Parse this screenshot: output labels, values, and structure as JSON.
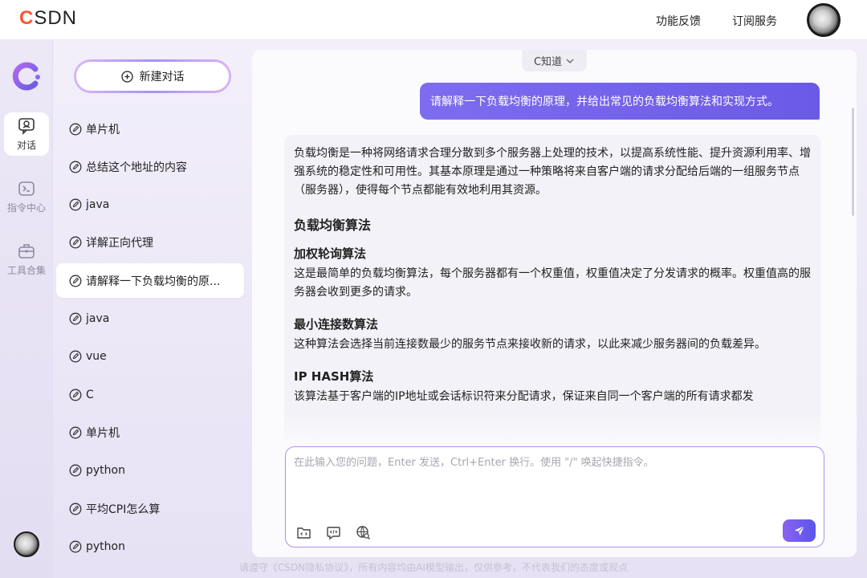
{
  "header": {
    "logo": "CSDN",
    "links": [
      "功能反馈",
      "订阅服务"
    ]
  },
  "rail": {
    "items": [
      {
        "label": "对话",
        "icon": "chat-bubble-icon",
        "active": true
      },
      {
        "label": "指令中心",
        "icon": "terminal-icon",
        "active": false
      },
      {
        "label": "工具合集",
        "icon": "briefcase-icon",
        "active": false
      }
    ]
  },
  "sidebar": {
    "new_chat_label": "新建对话",
    "conversations": [
      {
        "title": "单片机"
      },
      {
        "title": "总结这个地址的内容"
      },
      {
        "title": "java"
      },
      {
        "title": "详解正向代理"
      },
      {
        "title": "请解释一下负载均衡的原...",
        "active": true
      },
      {
        "title": "java"
      },
      {
        "title": "vue"
      },
      {
        "title": "C"
      },
      {
        "title": "单片机"
      },
      {
        "title": "python"
      },
      {
        "title": "平均CPI怎么算"
      },
      {
        "title": "python"
      }
    ]
  },
  "chat": {
    "model_select": "C知道",
    "user_message": "请解释一下负载均衡的原理，并给出常见的负载均衡算法和实现方式。",
    "ai_message": {
      "intro": "负载均衡是一种将网络请求合理分散到多个服务器上处理的技术，以提高系统性能、提升资源利用率、增强系统的稳定性和可用性。其基本原理是通过一种策略将来自客户端的请求分配给后端的一组服务节点（服务器），使得每个节点都能有效地利用其资源。",
      "heading": "负载均衡算法",
      "sections": [
        {
          "title": "加权轮询算法",
          "body": "这是最简单的负载均衡算法，每个服务器都有一个权重值，权重值决定了分发请求的概率。权重值高的服务器会收到更多的请求。"
        },
        {
          "title": "最小连接数算法",
          "body": "这种算法会选择当前连接数最少的服务节点来接收新的请求，以此来减少服务器间的负载差异。"
        },
        {
          "title": "IP HASH算法",
          "body": "该算法基于客户端的IP地址或会话标识符来分配请求，保证来自同一个客户端的所有请求都发"
        }
      ]
    },
    "input": {
      "placeholder": "在此输入您的问题，Enter 发送，Ctrl+Enter 换行。使用 \"/\" 唤起快捷指令。",
      "value": ""
    }
  },
  "footer": {
    "note": "请遵守《CSDN隐私协议》，所有内容均由AI模型输出，仅供参考，不代表我们的态度或观点"
  },
  "colors": {
    "brand": "#fc5531",
    "accent": "#6a5ae6",
    "accent_light": "#b08df0"
  }
}
